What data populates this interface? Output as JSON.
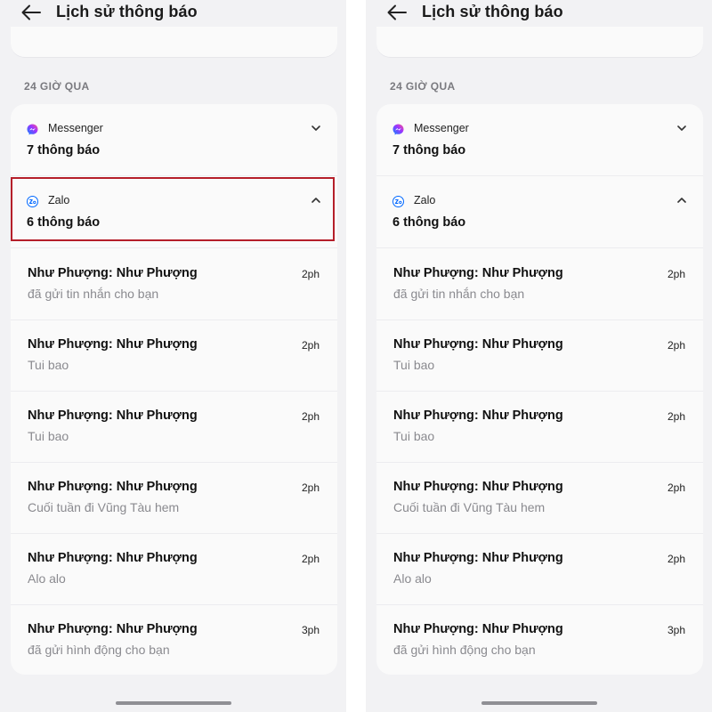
{
  "panels": [
    {
      "header": {
        "title": "Lịch sử thông báo"
      },
      "section_label": "24 GIỜ QUA",
      "groups": [
        {
          "app": "Messenger",
          "count": "7 thông báo",
          "expanded": false
        },
        {
          "app": "Zalo",
          "count": "6 thông báo",
          "expanded": true
        }
      ],
      "notifications": [
        {
          "sender": "Như Phượng: Như Phượng",
          "message": "đã gửi tin nhắn cho bạn",
          "time": "2ph"
        },
        {
          "sender": "Như Phượng: Như Phượng",
          "message": "Tui bao",
          "time": "2ph"
        },
        {
          "sender": "Như Phượng: Như Phượng",
          "message": "Tui bao",
          "time": "2ph"
        },
        {
          "sender": "Như Phượng: Như Phượng",
          "message": "Cuối tuần đi Vũng Tàu hem",
          "time": "2ph"
        },
        {
          "sender": "Như Phượng: Như Phượng",
          "message": "Alo alo",
          "time": "2ph"
        },
        {
          "sender": "Như Phượng: Như Phượng",
          "message": "đã gửi hình động cho bạn",
          "time": "3ph"
        }
      ]
    },
    {
      "header": {
        "title": "Lịch sử thông báo"
      },
      "section_label": "24 GIỜ QUA",
      "groups": [
        {
          "app": "Messenger",
          "count": "7 thông báo",
          "expanded": false
        },
        {
          "app": "Zalo",
          "count": "6 thông báo",
          "expanded": true
        }
      ],
      "notifications": [
        {
          "sender": "Như Phượng: Như Phượng",
          "message": "đã gửi tin nhắn cho bạn",
          "time": "2ph"
        },
        {
          "sender": "Như Phượng: Như Phượng",
          "message": "Tui bao",
          "time": "2ph"
        },
        {
          "sender": "Như Phượng: Như Phượng",
          "message": "Tui bao",
          "time": "2ph"
        },
        {
          "sender": "Như Phượng: Như Phượng",
          "message": "Cuối tuần đi Vũng Tàu hem",
          "time": "2ph"
        },
        {
          "sender": "Như Phượng: Như Phượng",
          "message": "Alo alo",
          "time": "2ph"
        },
        {
          "sender": "Như Phượng: Như Phượng",
          "message": "đã gửi hình động cho bạn",
          "time": "3ph"
        }
      ]
    }
  ],
  "icons": {
    "back": "arrow-left-icon",
    "messenger": "messenger-icon",
    "zalo": "zalo-icon",
    "collapsed": "chevron-down-icon",
    "expanded": "chevron-up-icon"
  },
  "colors": {
    "highlight_border": "#b51f2a",
    "messenger_gradient": [
      "#0a84ff",
      "#a033ff",
      "#ff5c87"
    ],
    "zalo_blue": "#0068ff"
  }
}
